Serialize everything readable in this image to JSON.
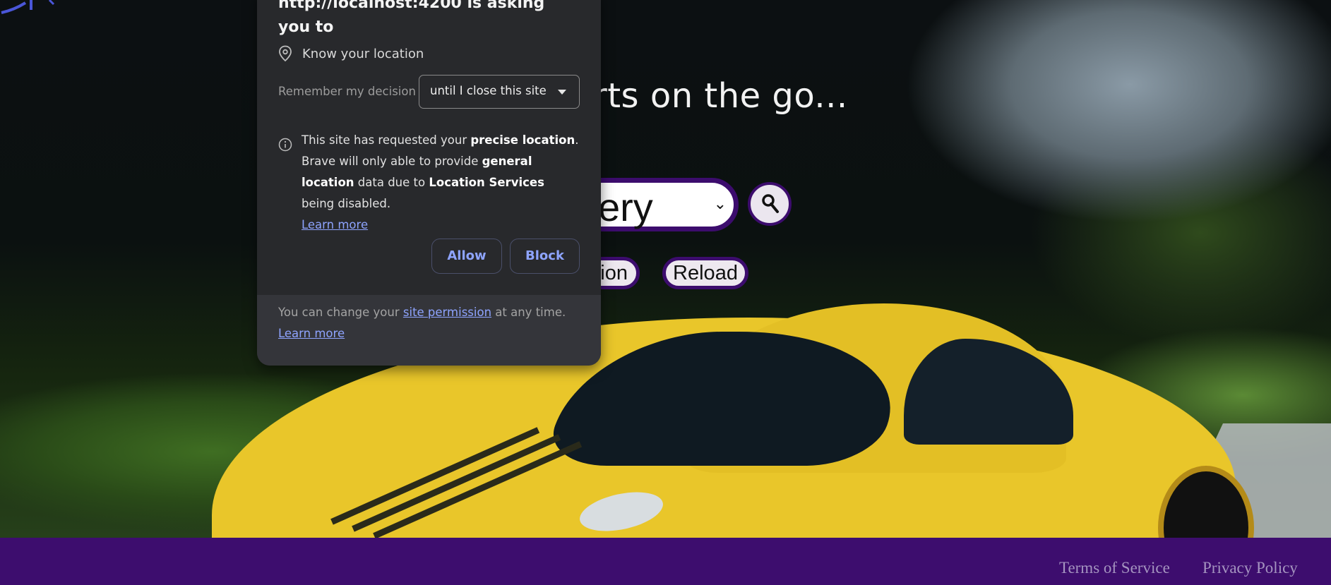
{
  "hero": {
    "tagline": "rts on the go...",
    "category_select_value": "ery",
    "location_button_label": "ion",
    "reload_button_label": "Reload",
    "search_icon": "search-icon"
  },
  "footer": {
    "terms_label": "Terms of Service",
    "privacy_label": "Privacy Policy"
  },
  "permission_popup": {
    "title": "http://localhost:4200 is asking you to",
    "permission_icon": "location-pin-icon",
    "permission_label": "Know your location",
    "remember_label": "Remember my decision",
    "remember_value": "until I close this site",
    "info_icon": "info-icon",
    "info_part1": "This site has requested your ",
    "info_bold1": "precise location",
    "info_part2": ". Brave will only able to provide ",
    "info_bold2": "general location",
    "info_part3": " data due to ",
    "info_bold3": "Location Services",
    "info_part4": " being disabled.",
    "info_learn_more": "Learn more",
    "allow_label": "Allow",
    "block_label": "Block",
    "footer_part1": "You can change your ",
    "footer_link": "site permission",
    "footer_part2": " at any time.",
    "footer_learn_more": "Learn more"
  },
  "colors": {
    "accent_purple": "#3d0d6e",
    "popup_bg": "#28292c",
    "link_blue": "#8ea4ff"
  }
}
